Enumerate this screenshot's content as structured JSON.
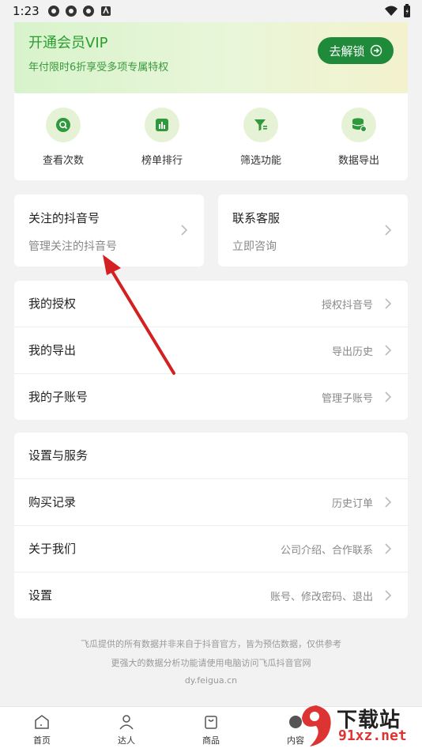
{
  "status": {
    "time": "1:23"
  },
  "vip": {
    "title": "开通会员VIP",
    "subtitle": "年付限时6折享受多项专属特权",
    "button": "去解锁"
  },
  "quick": [
    {
      "label": "查看次数",
      "icon": "search-icon"
    },
    {
      "label": "榜单排行",
      "icon": "bar-chart-icon"
    },
    {
      "label": "筛选功能",
      "icon": "filter-icon"
    },
    {
      "label": "数据导出",
      "icon": "database-export-icon"
    }
  ],
  "cards": [
    {
      "title": "关注的抖音号",
      "subtitle": "管理关注的抖音号"
    },
    {
      "title": "联系客服",
      "subtitle": "立即咨询"
    }
  ],
  "account_list": [
    {
      "label": "我的授权",
      "value": "授权抖音号"
    },
    {
      "label": "我的导出",
      "value": "导出历史"
    },
    {
      "label": "我的子账号",
      "value": "管理子账号"
    }
  ],
  "service": {
    "header": "设置与服务",
    "rows": [
      {
        "label": "购买记录",
        "value": "历史订单"
      },
      {
        "label": "关于我们",
        "value": "公司介绍、合作联系"
      },
      {
        "label": "设置",
        "value": "账号、修改密码、退出"
      }
    ]
  },
  "footer": {
    "line1": "飞瓜提供的所有数据并非来自于抖音官方，皆为预估数据，仅供参考",
    "line2": "更强大的数据分析功能请使用电脑访问飞瓜抖音官网",
    "line3": "dy.feigua.cn"
  },
  "tabs": [
    {
      "label": "首页",
      "icon": "home-icon"
    },
    {
      "label": "达人",
      "icon": "person-icon"
    },
    {
      "label": "商品",
      "icon": "bag-icon"
    },
    {
      "label": "内容",
      "icon": "content-icon"
    }
  ],
  "watermark": {
    "brand": "下载站",
    "url": "91xz.net"
  },
  "colors": {
    "accent": "#1f8a3a",
    "vip_text": "#2a9d2f",
    "icon_bg": "#e6f2d6",
    "arrow": "#d42020"
  }
}
